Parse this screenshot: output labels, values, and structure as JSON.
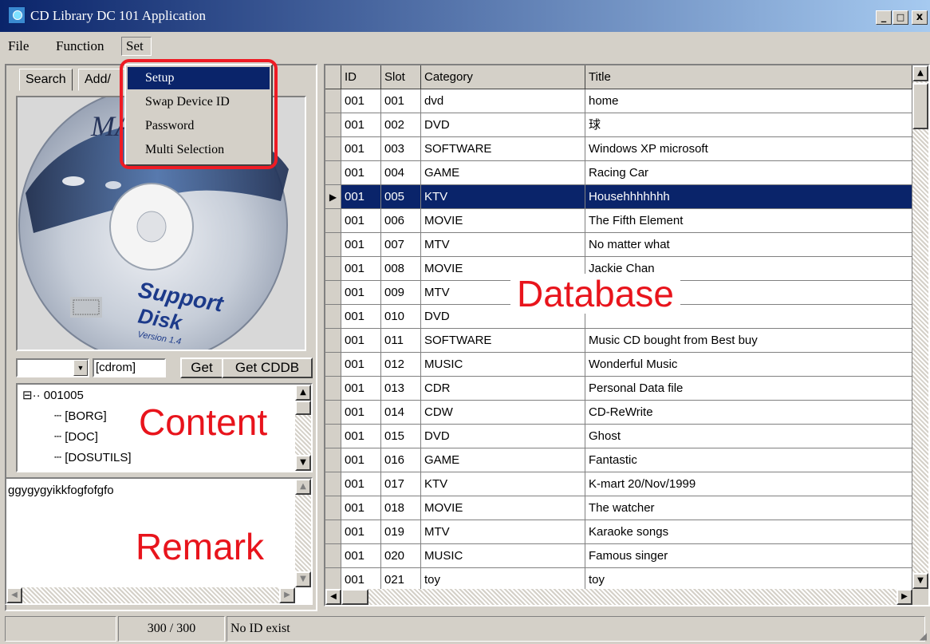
{
  "window": {
    "title": "CD Library DC 101 Application",
    "minimize": "_",
    "maximize": "□",
    "close": "x"
  },
  "menubar": {
    "file": "File",
    "function": "Function",
    "set": "Set"
  },
  "set_menu": {
    "items": [
      "Setup",
      "Swap Device ID",
      "Password",
      "Multi Selection"
    ],
    "highlighted": "Setup"
  },
  "left": {
    "tabs": [
      "Search",
      "Add/"
    ],
    "cd_label": {
      "brand": "MA",
      "support": "Support",
      "disk": "Disk",
      "version": "Version 1.4"
    },
    "drive_value": "[cdrom]",
    "get_button": "Get",
    "get_cddb_button": "Get CDDB",
    "tree": {
      "root_toggle": "⊟",
      "root": "001005",
      "children": [
        "[BORG]",
        "[DOC]",
        "[DOSUTILS]"
      ]
    },
    "remark_text": "ggygygyikkfogfofgfo"
  },
  "grid": {
    "columns": [
      "ID",
      "Slot",
      "Category",
      "Title"
    ],
    "selected_index": 4,
    "rows": [
      [
        "001",
        "001",
        "dvd",
        "home"
      ],
      [
        "001",
        "002",
        "DVD",
        "球"
      ],
      [
        "001",
        "003",
        "SOFTWARE",
        "Windows XP microsoft"
      ],
      [
        "001",
        "004",
        "GAME",
        "Racing Car"
      ],
      [
        "001",
        "005",
        "KTV",
        "Househhhhhhh"
      ],
      [
        "001",
        "006",
        "MOVIE",
        "The Fifth Element"
      ],
      [
        "001",
        "007",
        "MTV",
        "No matter what"
      ],
      [
        "001",
        "008",
        "MOVIE",
        "Jackie Chan"
      ],
      [
        "001",
        "009",
        "MTV",
        ""
      ],
      [
        "001",
        "010",
        "DVD",
        ""
      ],
      [
        "001",
        "011",
        "SOFTWARE",
        "Music CD bought from Best buy"
      ],
      [
        "001",
        "012",
        "MUSIC",
        "Wonderful Music"
      ],
      [
        "001",
        "013",
        "CDR",
        "Personal Data file"
      ],
      [
        "001",
        "014",
        "CDW",
        "CD-ReWrite"
      ],
      [
        "001",
        "015",
        "DVD",
        "Ghost"
      ],
      [
        "001",
        "016",
        "GAME",
        "Fantastic"
      ],
      [
        "001",
        "017",
        "KTV",
        "K-mart 20/Nov/1999"
      ],
      [
        "001",
        "018",
        "MOVIE",
        "The watcher"
      ],
      [
        "001",
        "019",
        "MTV",
        "Karaoke songs"
      ],
      [
        "001",
        "020",
        "MUSIC",
        "Famous singer"
      ],
      [
        "001",
        "021",
        "toy",
        "toy"
      ]
    ]
  },
  "annotations": {
    "database": "Database",
    "content": "Content",
    "remark": "Remark"
  },
  "status": {
    "count": "300 / 300",
    "message": "No ID exist"
  },
  "colors": {
    "selection": "#0a246a",
    "annotation": "#e8141c",
    "face": "#d4d0c8"
  }
}
